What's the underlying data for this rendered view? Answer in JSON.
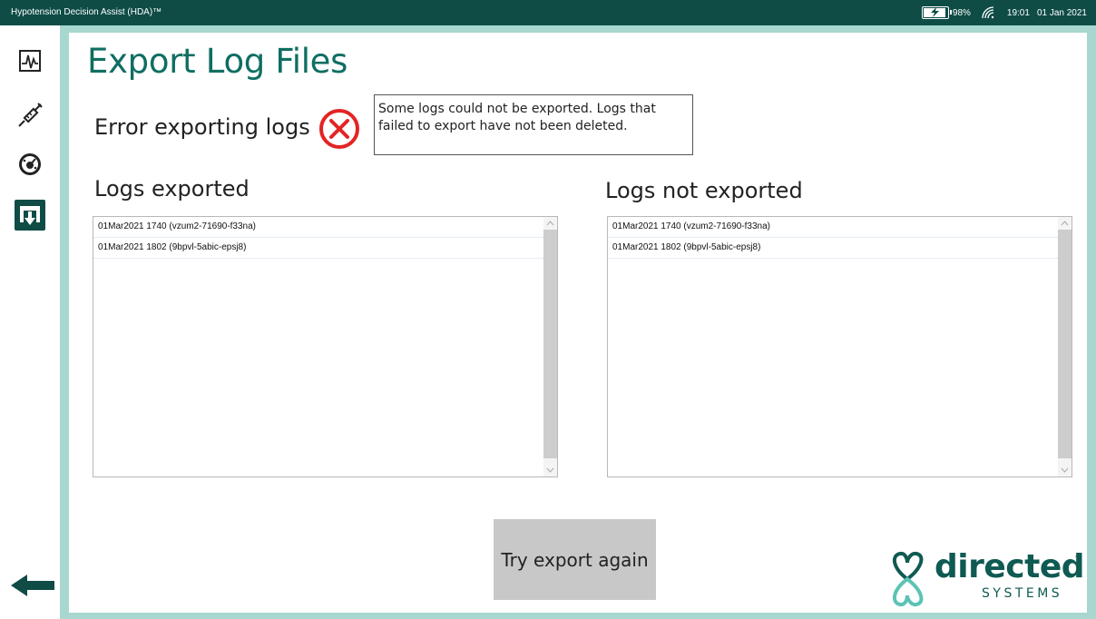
{
  "window": {
    "app_title": "Hypotension Decision Assist (HDA)™"
  },
  "status_bar": {
    "battery_level": 0.98,
    "battery_percent": "98%",
    "time": "19:01",
    "date": "01 Jan 2021",
    "icons": [
      "battery-charging-icon",
      "wifi-icon"
    ]
  },
  "sidebar": {
    "items": [
      {
        "name": "monitor",
        "icon": "waveform-chart-icon",
        "active": false
      },
      {
        "name": "syringe",
        "icon": "syringe-icon",
        "active": false
      },
      {
        "name": "settings",
        "icon": "gauge-settings-icon",
        "active": false
      },
      {
        "name": "export",
        "icon": "export-download-icon",
        "active": true
      }
    ],
    "back_icon": "back-arrow-icon"
  },
  "page": {
    "title": "Export Log Files",
    "error_label": "Error exporting logs",
    "error_icon": "error-x-circle-icon",
    "error_message": "Some logs could not be exported. Logs that failed to export have not been deleted.",
    "exported": {
      "heading": "Logs exported",
      "items": [
        "01Mar2021 1740 (vzum2-71690-f33na)",
        "01Mar2021 1802 (9bpvl-5abic-epsj8)"
      ]
    },
    "not_exported": {
      "heading": "Logs not exported",
      "items": [
        "01Mar2021 1740 (vzum2-71690-f33na)",
        "01Mar2021 1802 (9bpvl-5abic-epsj8)"
      ]
    },
    "retry_button": "Try export again"
  },
  "logo": {
    "text": "directed",
    "subtext": "SYSTEMS",
    "tm": "™"
  },
  "colors": {
    "titlebar": "#0f4c46",
    "accent": "#0f6e62",
    "frame": "#a8d7cf",
    "error": "#e32424",
    "button": "#c8c8c8"
  }
}
